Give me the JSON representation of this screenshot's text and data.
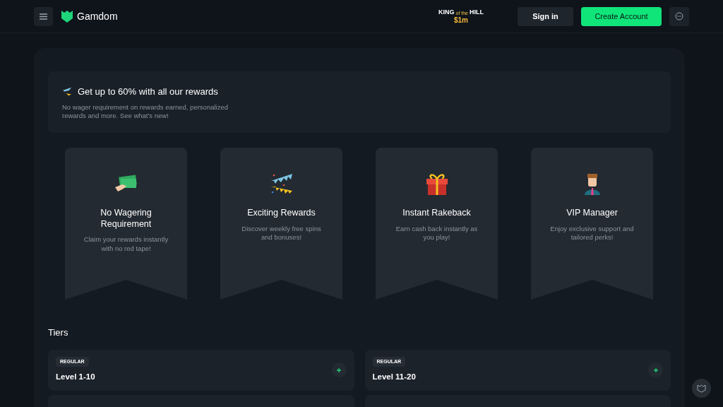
{
  "header": {
    "brand": "Gamdom",
    "promo_line1": "KING",
    "promo_small": "of the",
    "promo_line2": "HILL",
    "promo_amount": "$1m",
    "sign_in": "Sign in",
    "create_account": "Create Account"
  },
  "banner": {
    "title": "Get up to 60% with all our rewards",
    "text": "No wager requirement on rewards earned, personalized rewards and more. See what's new!"
  },
  "features": [
    {
      "kind": "cash",
      "title": "No Wagering Requirement",
      "text": "Claim your rewards instantly with no red tape!"
    },
    {
      "kind": "bunting",
      "title": "Exciting Rewards",
      "text": "Discover weekly free spins and bonuses!"
    },
    {
      "kind": "gift",
      "title": "Instant Rakeback",
      "text": "Earn cash back instantly as you play!"
    },
    {
      "kind": "manager",
      "title": "VIP Manager",
      "text": "Enjoy exclusive support and tailored perks!"
    }
  ],
  "tiers_title": "Tiers",
  "tiers": [
    {
      "badge": "REGULAR",
      "title": "Level 1-10"
    },
    {
      "badge": "REGULAR",
      "title": "Level 11-20"
    }
  ]
}
